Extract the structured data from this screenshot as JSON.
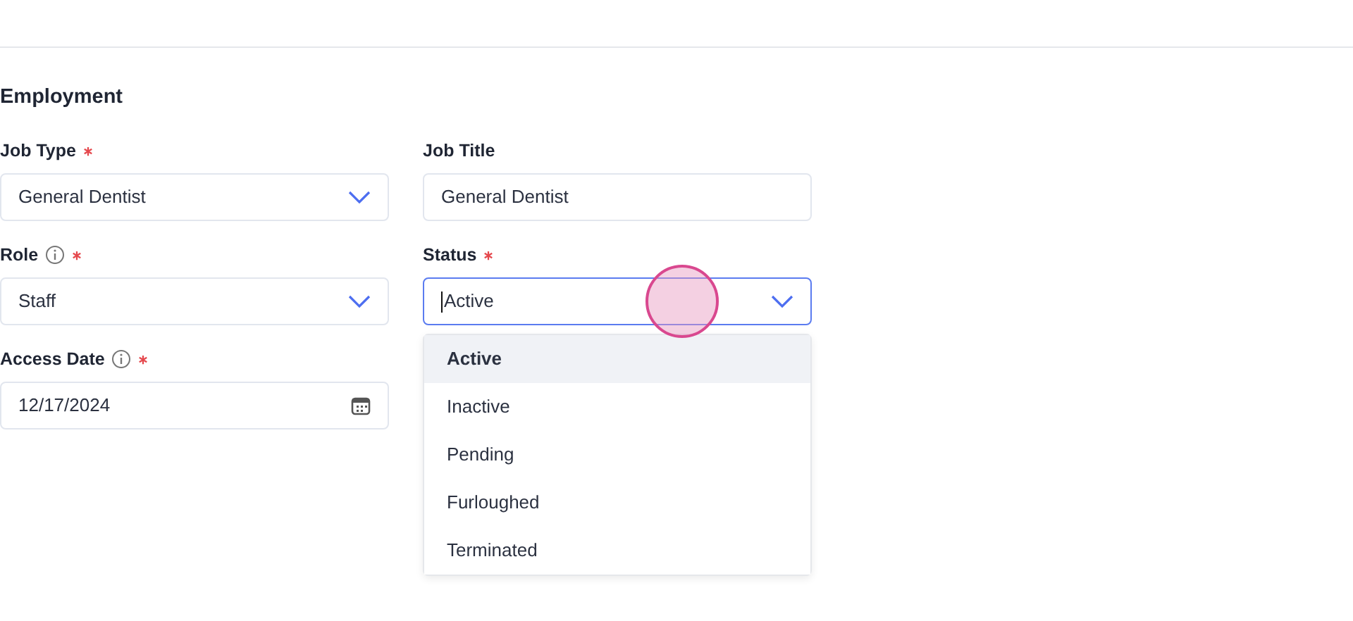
{
  "section": {
    "title": "Employment"
  },
  "fields": [
    {
      "kind": "select",
      "label": "Job Type",
      "required": true,
      "info": false,
      "value": "General Dentist",
      "open": false
    },
    {
      "kind": "text",
      "label": "Job Title",
      "required": false,
      "info": false,
      "value": "General Dentist"
    },
    {
      "kind": "select",
      "label": "Role",
      "required": true,
      "info": true,
      "value": "Staff",
      "open": false
    },
    {
      "kind": "select",
      "label": "Status",
      "required": true,
      "info": false,
      "value": "Active",
      "open": true,
      "options": [
        {
          "label": "Active",
          "selected": true
        },
        {
          "label": "Inactive",
          "selected": false
        },
        {
          "label": "Pending",
          "selected": false
        },
        {
          "label": "Furloughed",
          "selected": false
        },
        {
          "label": "Terminated",
          "selected": false
        }
      ]
    },
    {
      "kind": "date",
      "label": "Access Date",
      "required": true,
      "info": true,
      "value": "12/17/2024"
    }
  ],
  "click_marker": true
}
